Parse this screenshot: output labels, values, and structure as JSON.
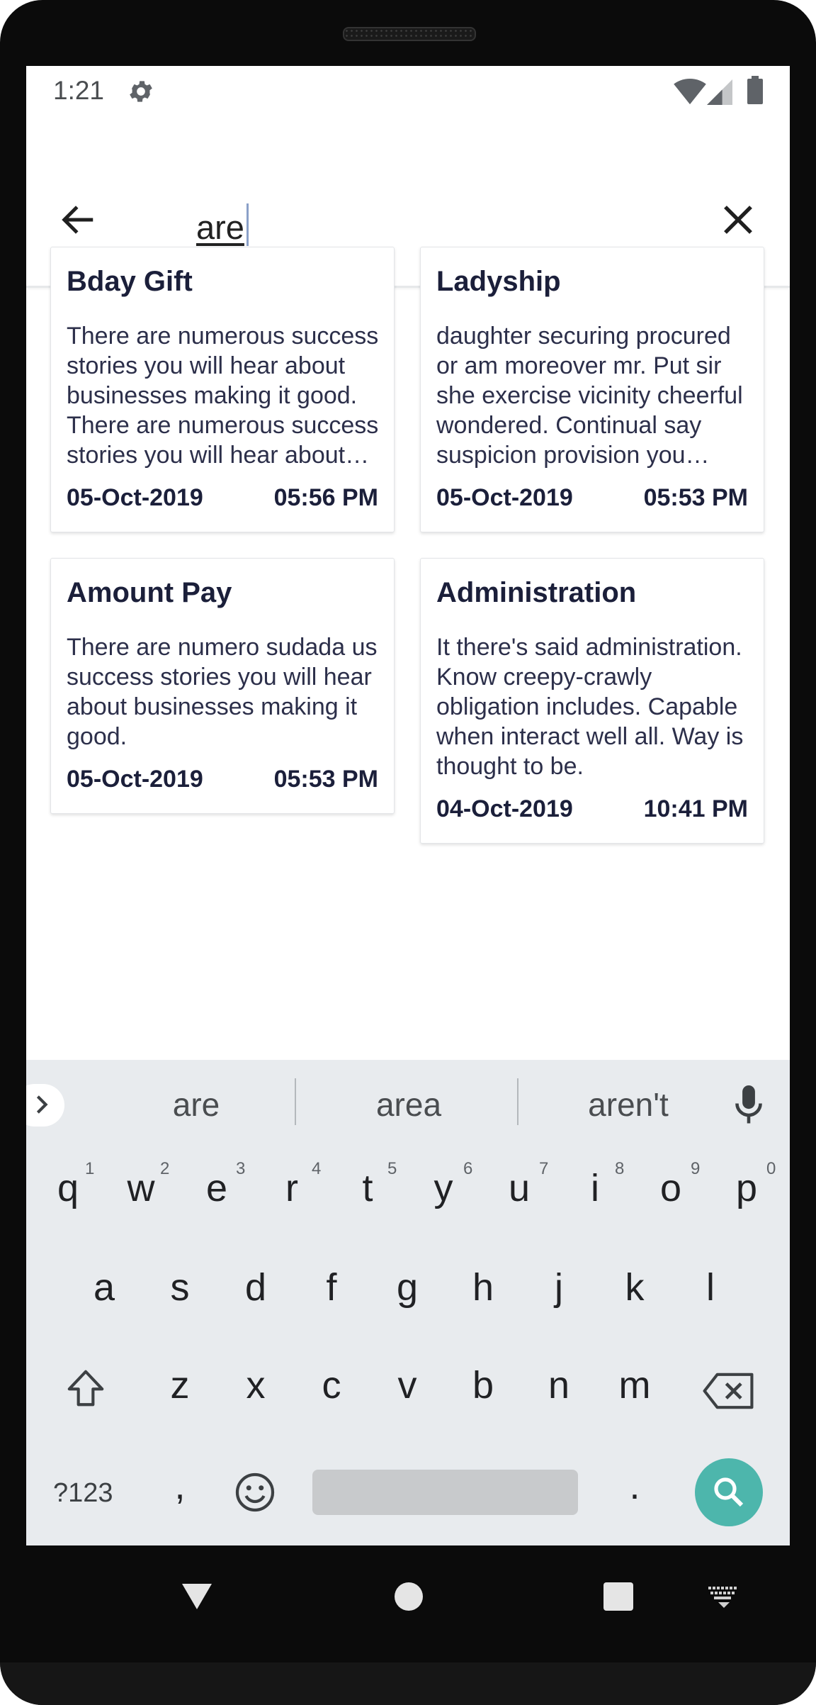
{
  "status_bar": {
    "time": "1:21"
  },
  "search": {
    "query": "are"
  },
  "notes": [
    {
      "title": "Bday Gift",
      "body": "There are numerous success stories you will hear about businesses making it good. There are numerous success stories you will hear about businesses making it good.",
      "date": "05-Oct-2019",
      "time": "05:56 PM"
    },
    {
      "title": "Ladyship",
      "body": "daughter securing procured or am moreover mr. Put sir she exercise vicinity cheerful wondered. Continual say suspicion provision you neglected sir curiosity unwilling.",
      "date": "05-Oct-2019",
      "time": "05:53 PM"
    },
    {
      "title": "Amount Pay",
      "body": "There are numero sudada us success stories you will hear about businesses making it good.",
      "date": "05-Oct-2019",
      "time": "05:53 PM"
    },
    {
      "title": "Administration",
      "body": "It there's said administration. Know creepy-crawly obligation includes. Capable when interact well all. Way is thought to be.",
      "date": "04-Oct-2019",
      "time": "10:41 PM"
    }
  ],
  "keyboard": {
    "suggestions": [
      "are",
      "area",
      "aren't"
    ],
    "row1": [
      "q",
      "w",
      "e",
      "r",
      "t",
      "y",
      "u",
      "i",
      "o",
      "p"
    ],
    "row1_hints": [
      "1",
      "2",
      "3",
      "4",
      "5",
      "6",
      "7",
      "8",
      "9",
      "0"
    ],
    "row2": [
      "a",
      "s",
      "d",
      "f",
      "g",
      "h",
      "j",
      "k",
      "l"
    ],
    "row3": [
      "z",
      "x",
      "c",
      "v",
      "b",
      "n",
      "m"
    ],
    "symbols_label": "?123",
    "comma": ",",
    "period": "."
  },
  "colors": {
    "accent": "#4db6ac",
    "title_text": "#1b1f3a",
    "keyboard_bg": "#e8ebee"
  }
}
